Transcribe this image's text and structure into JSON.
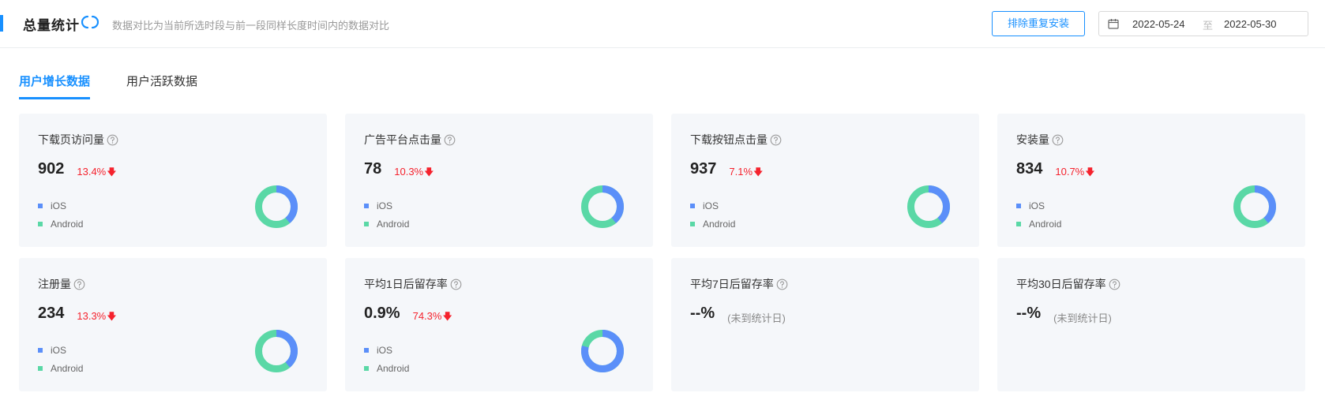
{
  "header": {
    "title": "总量统计",
    "description": "数据对比为当前所选时段与前一段同样长度时间内的数据对比",
    "dedupe_button": "排除重复安装",
    "date_start": "2022-05-24",
    "date_separator": "至",
    "date_end": "2022-05-30"
  },
  "tabs": [
    {
      "label": "用户增长数据",
      "active": true
    },
    {
      "label": "用户活跃数据",
      "active": false
    }
  ],
  "legend": {
    "ios": "iOS",
    "android": "Android"
  },
  "colors": {
    "ios": "#5b8ff9",
    "android": "#5ad8a6",
    "accent": "#1890ff",
    "down": "#f5222d"
  },
  "cards": [
    {
      "name": "下载页访问量",
      "value": "902",
      "change": "13.4%",
      "trend": "down",
      "ios_share": 0.39
    },
    {
      "name": "广告平台点击量",
      "value": "78",
      "change": "10.3%",
      "trend": "down",
      "ios_share": 0.39
    },
    {
      "name": "下载按钮点击量",
      "value": "937",
      "change": "7.1%",
      "trend": "down",
      "ios_share": 0.39
    },
    {
      "name": "安装量",
      "value": "834",
      "change": "10.7%",
      "trend": "down",
      "ios_share": 0.39
    },
    {
      "name": "注册量",
      "value": "234",
      "change": "13.3%",
      "trend": "down",
      "ios_share": 0.39
    },
    {
      "name": "平均1日后留存率",
      "value": "0.9%",
      "change": "74.3%",
      "trend": "down",
      "ios_share": 0.79
    },
    {
      "name": "平均7日后留存率",
      "value": "--%",
      "note": "(未到统计日)"
    },
    {
      "name": "平均30日后留存率",
      "value": "--%",
      "note": "(未到统计日)"
    }
  ]
}
